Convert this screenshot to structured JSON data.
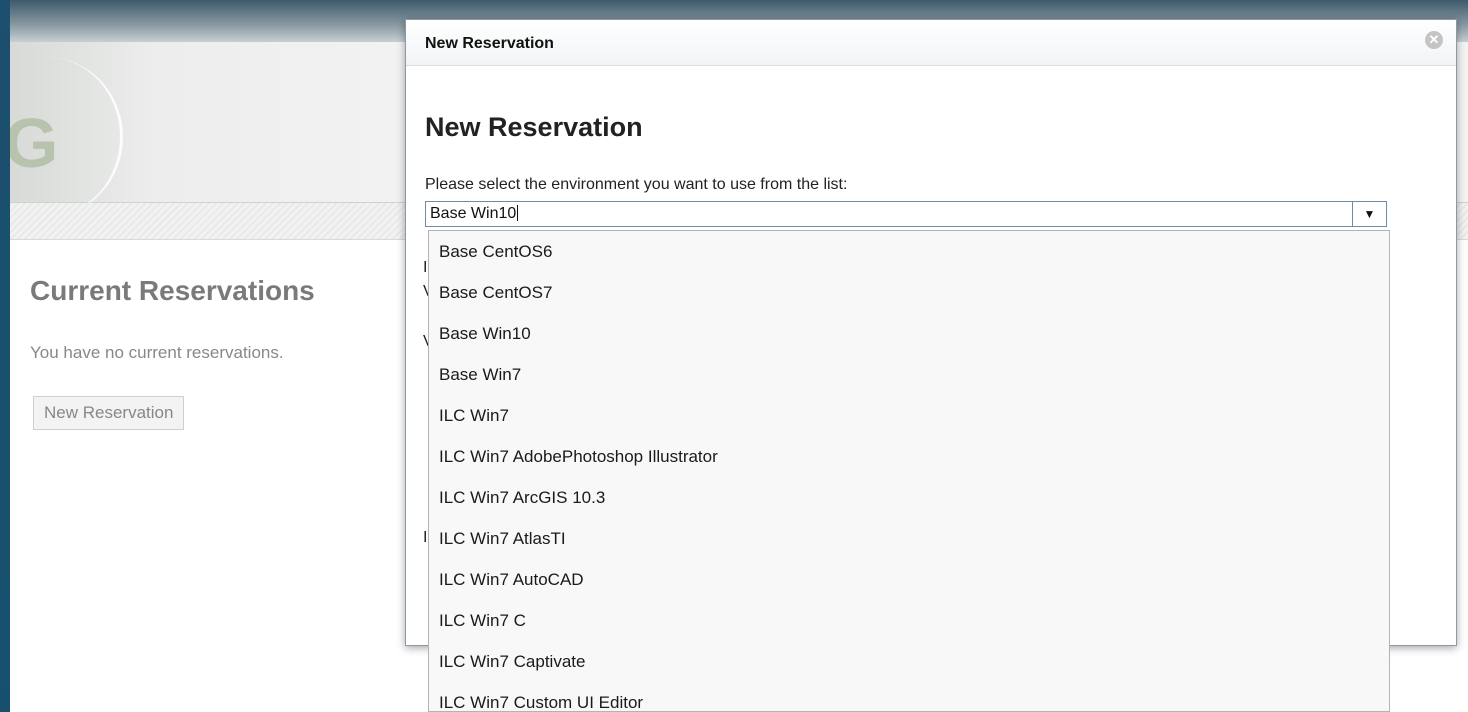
{
  "background_page": {
    "logo_fragment": "G",
    "current_reservations_heading": "Current Reservations",
    "no_reservations_text": "You have no current reservations.",
    "new_reservation_button": "New Reservation"
  },
  "dialog": {
    "title": "New Reservation",
    "close_icon": "close-icon",
    "heading": "New Reservation",
    "environment_prompt": "Please select the environment you want to use from the list:",
    "selected_environment": "Base Win10",
    "clipped_chars": [
      "I",
      "V",
      "V",
      "I"
    ]
  },
  "environment_options": [
    "Base CentOS6",
    "Base CentOS7",
    "Base Win10",
    "Base Win7",
    "ILC Win7",
    "ILC Win7 AdobePhotoshop Illustrator",
    "ILC Win7 ArcGIS 10.3",
    "ILC Win7 AtlasTI",
    "ILC Win7 AutoCAD",
    "ILC Win7 C",
    "ILC Win7 Captivate",
    "ILC Win7 Custom UI Editor"
  ]
}
